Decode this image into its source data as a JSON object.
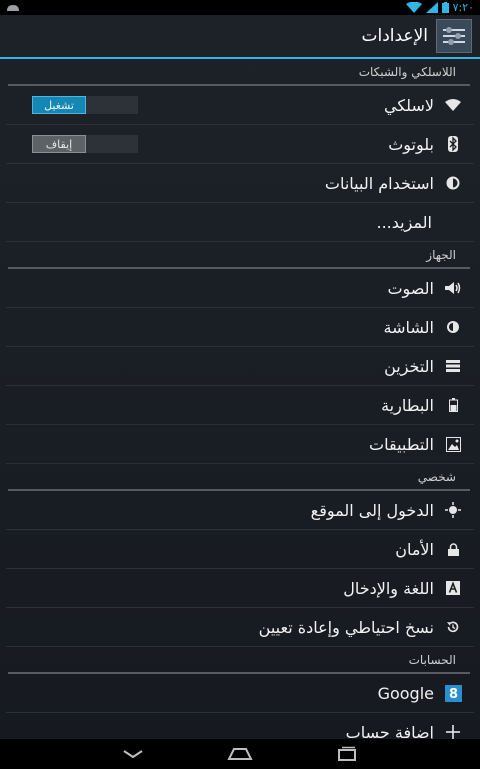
{
  "status_bar": {
    "time": "٧:٢٠",
    "notification_icon": "android-notification-icon"
  },
  "action_bar": {
    "title": "الإعدادات",
    "icon": "settings-sliders-icon"
  },
  "sections": [
    {
      "header": "اللاسلكي والشبكات",
      "items": [
        {
          "label": "لاسلكي",
          "icon": "wifi-icon",
          "toggle": "تشغيل",
          "toggle_state": "on"
        },
        {
          "label": "بلوتوث",
          "icon": "bluetooth-icon",
          "toggle": "إيقاف",
          "toggle_state": "off"
        },
        {
          "label": "استخدام البيانات",
          "icon": "data-usage-icon"
        },
        {
          "label": "المزيد..."
        }
      ]
    },
    {
      "header": "الجهاز",
      "items": [
        {
          "label": "الصوت",
          "icon": "speaker-icon"
        },
        {
          "label": "الشاشة",
          "icon": "display-brightness-icon"
        },
        {
          "label": "التخزين",
          "icon": "storage-icon"
        },
        {
          "label": "البطارية",
          "icon": "battery-icon"
        },
        {
          "label": "التطبيقات",
          "icon": "apps-icon"
        }
      ]
    },
    {
      "header": "شخصي",
      "items": [
        {
          "label": "الدخول إلى الموقع",
          "icon": "location-icon"
        },
        {
          "label": "الأمان",
          "icon": "lock-icon"
        },
        {
          "label": "اللغة والإدخال",
          "icon": "keyboard-a-icon"
        },
        {
          "label": "نسخ احتياطي وإعادة تعيين",
          "icon": "backup-restore-icon"
        }
      ]
    },
    {
      "header": "الحسابات",
      "items": [
        {
          "label": "Google",
          "icon": "google-account-icon"
        },
        {
          "label": "إضافة حساب",
          "icon": "add-icon"
        }
      ]
    }
  ],
  "colors": {
    "accent": "#33b5e5",
    "toggle_on": "#1687b5",
    "background": "#1a1f25"
  }
}
